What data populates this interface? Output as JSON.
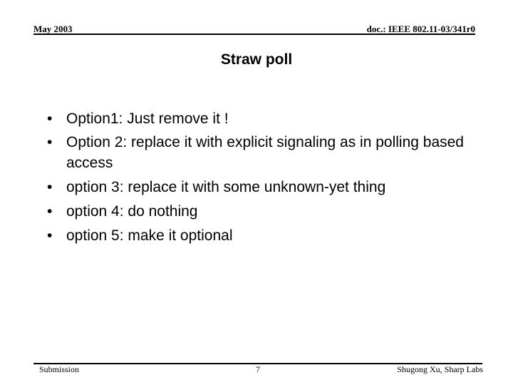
{
  "header": {
    "date": "May 2003",
    "doc_id": "doc.: IEEE 802.11-03/341r0"
  },
  "slide": {
    "title": "Straw poll",
    "bullet_glyph": "•",
    "bullets": [
      "Option1: Just remove it !",
      "Option 2: replace it with explicit signaling as in polling based access",
      "option 3: replace it with some unknown-yet thing",
      "option 4: do nothing",
      "option 5: make it optional"
    ]
  },
  "footer": {
    "left": "Submission",
    "page_number": "7",
    "author": "Shugong Xu, Sharp Labs"
  }
}
